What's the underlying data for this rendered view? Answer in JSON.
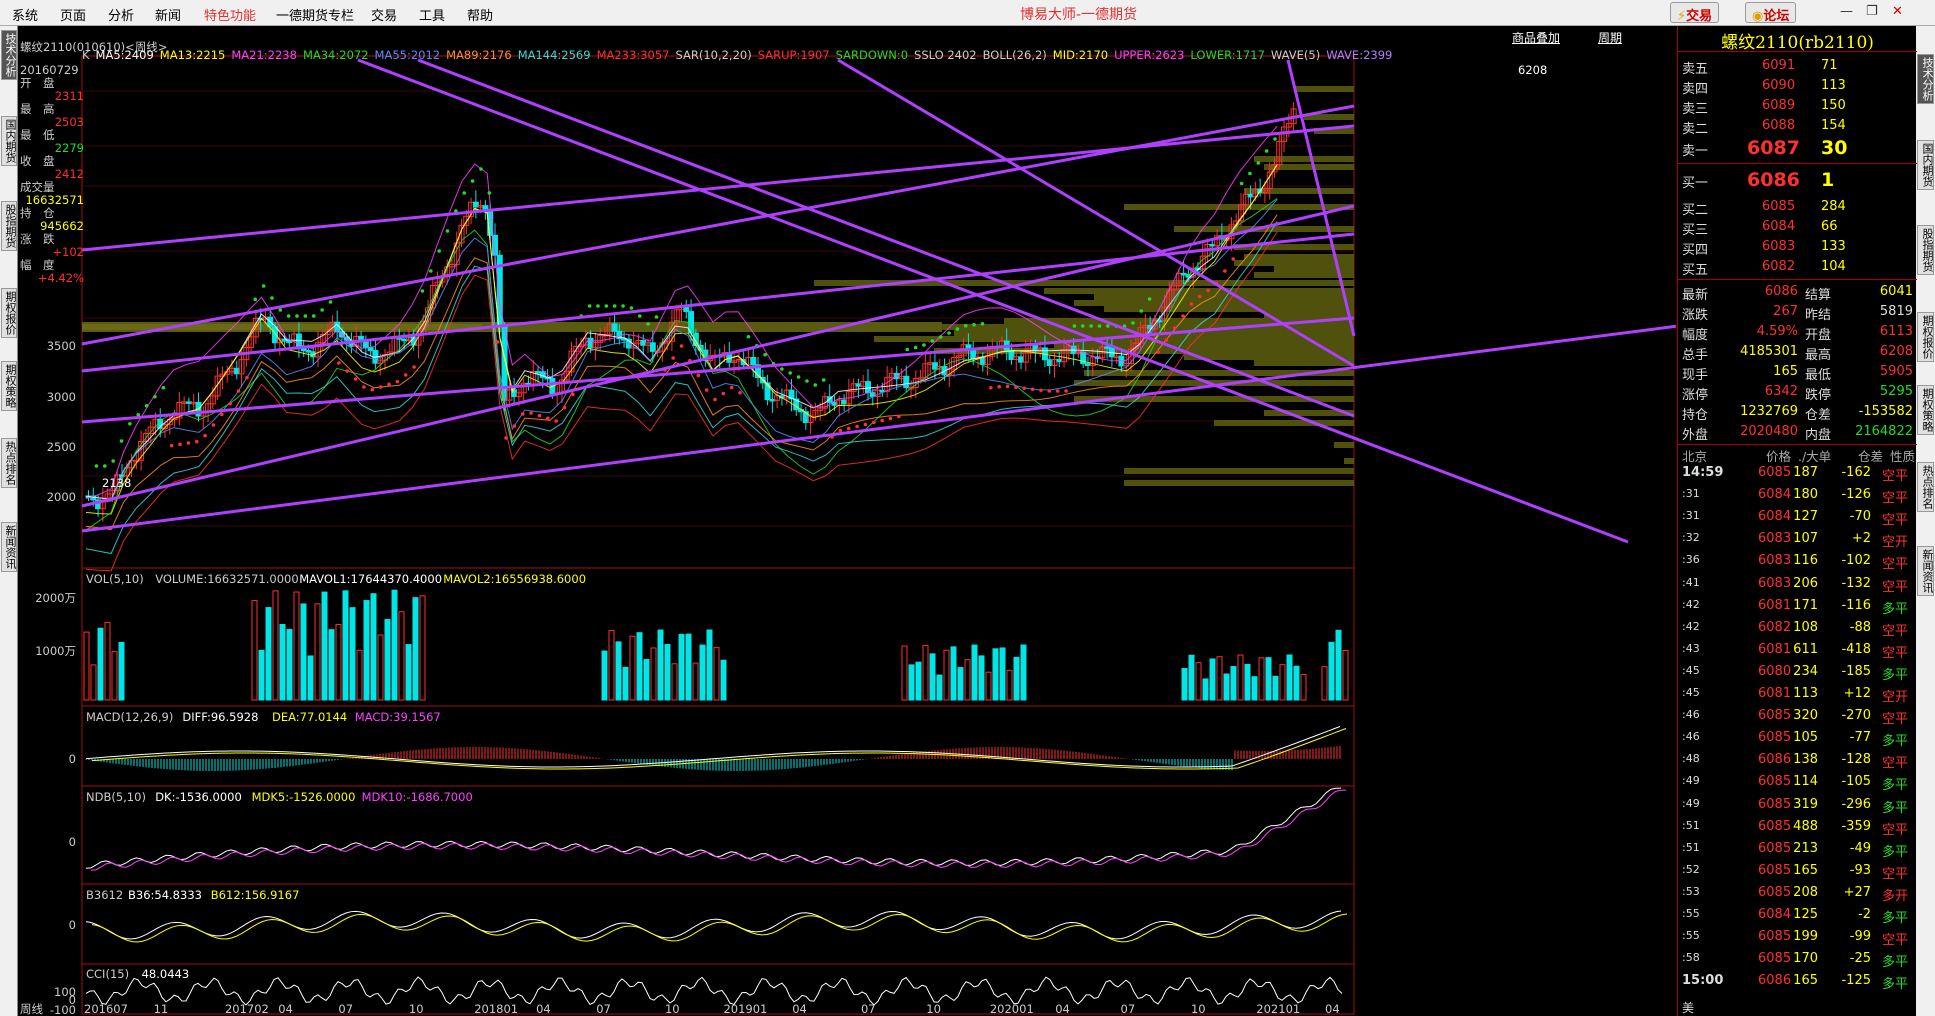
{
  "menu": {
    "items": [
      "系统",
      "页面",
      "分析",
      "新闻",
      "特色功能",
      "一德期货专栏",
      "交易",
      "工具",
      "帮助"
    ],
    "title": "博易大师-一德期货",
    "trade_btn": "交易",
    "forum_btn": "论坛"
  },
  "left_tabs": [
    "技术分析",
    "国内期货",
    "股指期货",
    "期权报价",
    "期权策略",
    "热点排名",
    "新闻资讯"
  ],
  "right_tabs": [
    "技术分析",
    "国内期货",
    "股指期货",
    "期权报价",
    "期权策略",
    "热点排名",
    "新闻资讯"
  ],
  "chart_header": {
    "instrument": "螺纹2110(010610)<周线>",
    "add_product": "商品叠加",
    "period": "周期"
  },
  "main_indicators": [
    {
      "text": "K",
      "color": "#cccccc"
    },
    {
      "text": "MA5:2409",
      "color": "#ffffff"
    },
    {
      "text": "MA13:2215",
      "color": "#ffff00"
    },
    {
      "text": "MA21:2238",
      "color": "#ff40ff"
    },
    {
      "text": "MA34:2072",
      "color": "#22dd22"
    },
    {
      "text": "MA55:2012",
      "color": "#5a8cff"
    },
    {
      "text": "MA89:2176",
      "color": "#ff9020"
    },
    {
      "text": "MA144:2569",
      "color": "#33dddd"
    },
    {
      "text": "MA233:3057",
      "color": "#ff3030"
    },
    {
      "text": "SAR(10,2,20)",
      "color": "#cccccc"
    },
    {
      "text": "SARUP:1907",
      "color": "#ff3030"
    },
    {
      "text": "SARDOWN:0",
      "color": "#22dd22"
    },
    {
      "text": "SSLO 2402",
      "color": "#cccccc"
    },
    {
      "text": "BOLL(26,2)",
      "color": "#cccccc"
    },
    {
      "text": "MID:2170",
      "color": "#ffff00"
    },
    {
      "text": "UPPER:2623",
      "color": "#ff40ff"
    },
    {
      "text": "LOWER:1717",
      "color": "#22dd22"
    },
    {
      "text": "WAVE(5)",
      "color": "#cccccc"
    },
    {
      "text": "WAVE:2399",
      "color": "#b080ff"
    }
  ],
  "info_box": [
    {
      "label": "20160729",
      "value": ""
    },
    {
      "label": "开　盘",
      "value": "2311",
      "color": "#ff3030"
    },
    {
      "label": "最　高",
      "value": "2503",
      "color": "#ff3030"
    },
    {
      "label": "最　低",
      "value": "2279",
      "color": "#22dd22"
    },
    {
      "label": "收　盘",
      "value": "2412",
      "color": "#ff3030"
    },
    {
      "label": "成交量",
      "value": "16632571",
      "color": "#ffff00"
    },
    {
      "label": "持　仓",
      "value": "945662",
      "color": "#ffff00"
    },
    {
      "label": "涨　跌",
      "value": "+102",
      "color": "#ff3030"
    },
    {
      "label": "幅　度",
      "value": "+4.42%",
      "color": "#ff3030"
    }
  ],
  "price_axis": [
    "3500",
    "3000",
    "2500",
    "2000"
  ],
  "marks": {
    "high": "6208",
    "low": "2138"
  },
  "vol_header": [
    {
      "text": "VOL(5,10)",
      "color": "#cccccc"
    },
    {
      "text": "VOLUME:16632571.0000",
      "color": "#cccccc"
    },
    {
      "text": "MAVOL1:17644370.4000",
      "color": "#ffffff"
    },
    {
      "text": "MAVOL2:16556938.6000",
      "color": "#ffff00"
    }
  ],
  "vol_axis": [
    "2000万",
    "1000万"
  ],
  "macd_header": [
    {
      "text": "MACD(12,26,9)",
      "color": "#cccccc"
    },
    {
      "text": "DIFF:96.5928",
      "color": "#ffffff"
    },
    {
      "text": "DEA:77.0144",
      "color": "#ffff00"
    },
    {
      "text": "MACD:39.1567",
      "color": "#ff40ff"
    }
  ],
  "ndb_header": [
    {
      "text": "NDB(5,10)",
      "color": "#cccccc"
    },
    {
      "text": "DK:-1536.0000",
      "color": "#ffffff"
    },
    {
      "text": "MDK5:-1526.0000",
      "color": "#ffff00"
    },
    {
      "text": "MDK10:-1686.7000",
      "color": "#ff40ff"
    }
  ],
  "b3612_header": [
    {
      "text": "B3612",
      "color": "#cccccc"
    },
    {
      "text": "B36:54.8333",
      "color": "#ffffff"
    },
    {
      "text": "B612:156.9167",
      "color": "#ffff00"
    }
  ],
  "cci_header": [
    {
      "text": "CCI(15)",
      "color": "#cccccc"
    },
    {
      "text": "48.0443",
      "color": "#ffffff"
    }
  ],
  "zero": "0",
  "cci_axis": [
    "100",
    "0",
    "-100"
  ],
  "time_axis": {
    "label": "周线",
    "ticks": [
      "201607",
      "11",
      "201702",
      "04",
      "07",
      "10",
      "201801",
      "04",
      "07",
      "10",
      "201901",
      "04",
      "07",
      "10",
      "202001",
      "04",
      "07",
      "10",
      "202101",
      "04"
    ]
  },
  "quote": {
    "title": "螺纹2110(rb2110)",
    "asks": [
      {
        "label": "卖五",
        "price": "6091",
        "vol": "71"
      },
      {
        "label": "卖四",
        "price": "6090",
        "vol": "113"
      },
      {
        "label": "卖三",
        "price": "6089",
        "vol": "150"
      },
      {
        "label": "卖二",
        "price": "6088",
        "vol": "154"
      },
      {
        "label": "卖一",
        "price": "6087",
        "vol": "30"
      }
    ],
    "bids": [
      {
        "label": "买一",
        "price": "6086",
        "vol": "1"
      },
      {
        "label": "买二",
        "price": "6085",
        "vol": "284"
      },
      {
        "label": "买三",
        "price": "6084",
        "vol": "66"
      },
      {
        "label": "买四",
        "price": "6083",
        "vol": "133"
      },
      {
        "label": "买五",
        "price": "6082",
        "vol": "104"
      }
    ],
    "stats": [
      {
        "l1": "最新",
        "v1": "6086",
        "c1": "#ff3030",
        "l2": "结算",
        "v2": "6041",
        "c2": "#ffff00"
      },
      {
        "l1": "涨跌",
        "v1": "267",
        "c1": "#ff3030",
        "l2": "昨结",
        "v2": "5819",
        "c2": "#dddddd"
      },
      {
        "l1": "幅度",
        "v1": "4.59%",
        "c1": "#ff3030",
        "l2": "开盘",
        "v2": "6113",
        "c2": "#ff3030"
      },
      {
        "l1": "总手",
        "v1": "4185301",
        "c1": "#ffff00",
        "l2": "最高",
        "v2": "6208",
        "c2": "#ff3030"
      },
      {
        "l1": "现手",
        "v1": "165",
        "c1": "#ffff00",
        "l2": "最低",
        "v2": "5905",
        "c2": "#ff3030"
      },
      {
        "l1": "涨停",
        "v1": "6342",
        "c1": "#ff3030",
        "l2": "跌停",
        "v2": "5295",
        "c2": "#22dd22"
      },
      {
        "l1": "持仓",
        "v1": "1232769",
        "c1": "#ffff00",
        "l2": "仓差",
        "v2": "-153582",
        "c2": "#ffff00"
      },
      {
        "l1": "外盘",
        "v1": "2020480",
        "c1": "#ff3030",
        "l2": "内盘",
        "v2": "2164822",
        "c2": "#22dd22"
      }
    ],
    "ticks_header": [
      "北京",
      "价格",
      "./大单",
      "仓差",
      "性质"
    ],
    "ticks": [
      {
        "t": "14:59",
        "p": "6085",
        "v": "187",
        "d": "-162",
        "n": "空平",
        "nc": "#ff3030"
      },
      {
        "t": ":31",
        "p": "6084",
        "v": "180",
        "d": "-126",
        "n": "空平",
        "nc": "#ff3030"
      },
      {
        "t": ":31",
        "p": "6084",
        "v": "127",
        "d": "-70",
        "n": "空平",
        "nc": "#ff3030"
      },
      {
        "t": ":32",
        "p": "6083",
        "v": "107",
        "d": "+2",
        "n": "空开",
        "nc": "#ff3030"
      },
      {
        "t": ":36",
        "p": "6083",
        "v": "116",
        "d": "-102",
        "n": "空平",
        "nc": "#ff3030"
      },
      {
        "t": ":41",
        "p": "6083",
        "v": "206",
        "d": "-132",
        "n": "空平",
        "nc": "#ff3030"
      },
      {
        "t": ":42",
        "p": "6081",
        "v": "171",
        "d": "-116",
        "n": "多平",
        "nc": "#22dd22"
      },
      {
        "t": ":42",
        "p": "6082",
        "v": "108",
        "d": "-88",
        "n": "空平",
        "nc": "#ff3030"
      },
      {
        "t": ":43",
        "p": "6081",
        "v": "611",
        "d": "-418",
        "n": "空平",
        "nc": "#ff3030"
      },
      {
        "t": ":45",
        "p": "6080",
        "v": "234",
        "d": "-185",
        "n": "多平",
        "nc": "#22dd22"
      },
      {
        "t": ":45",
        "p": "6081",
        "v": "113",
        "d": "+12",
        "n": "空开",
        "nc": "#ff3030"
      },
      {
        "t": ":46",
        "p": "6085",
        "v": "320",
        "d": "-270",
        "n": "空平",
        "nc": "#ff3030"
      },
      {
        "t": ":46",
        "p": "6085",
        "v": "105",
        "d": "-77",
        "n": "多平",
        "nc": "#22dd22"
      },
      {
        "t": ":48",
        "p": "6086",
        "v": "138",
        "d": "-128",
        "n": "空平",
        "nc": "#ff3030"
      },
      {
        "t": ":49",
        "p": "6085",
        "v": "114",
        "d": "-105",
        "n": "多平",
        "nc": "#22dd22"
      },
      {
        "t": ":49",
        "p": "6085",
        "v": "319",
        "d": "-296",
        "n": "多平",
        "nc": "#22dd22"
      },
      {
        "t": ":51",
        "p": "6085",
        "v": "488",
        "d": "-359",
        "n": "空平",
        "nc": "#ff3030"
      },
      {
        "t": ":51",
        "p": "6085",
        "v": "213",
        "d": "-49",
        "n": "多平",
        "nc": "#22dd22"
      },
      {
        "t": ":52",
        "p": "6085",
        "v": "165",
        "d": "-93",
        "n": "空平",
        "nc": "#ff3030"
      },
      {
        "t": ":53",
        "p": "6085",
        "v": "208",
        "d": "+27",
        "n": "多开",
        "nc": "#ff3030"
      },
      {
        "t": ":55",
        "p": "6084",
        "v": "125",
        "d": "-2",
        "n": "多平",
        "nc": "#22dd22"
      },
      {
        "t": ":55",
        "p": "6085",
        "v": "199",
        "d": "-99",
        "n": "空平",
        "nc": "#ff3030"
      },
      {
        "t": ":58",
        "p": "6085",
        "v": "170",
        "d": "-25",
        "n": "多平",
        "nc": "#22dd22"
      },
      {
        "t": "15:00",
        "p": "6086",
        "v": "165",
        "d": "-125",
        "n": "多平",
        "nc": "#22dd22"
      }
    ],
    "footer": "美"
  }
}
